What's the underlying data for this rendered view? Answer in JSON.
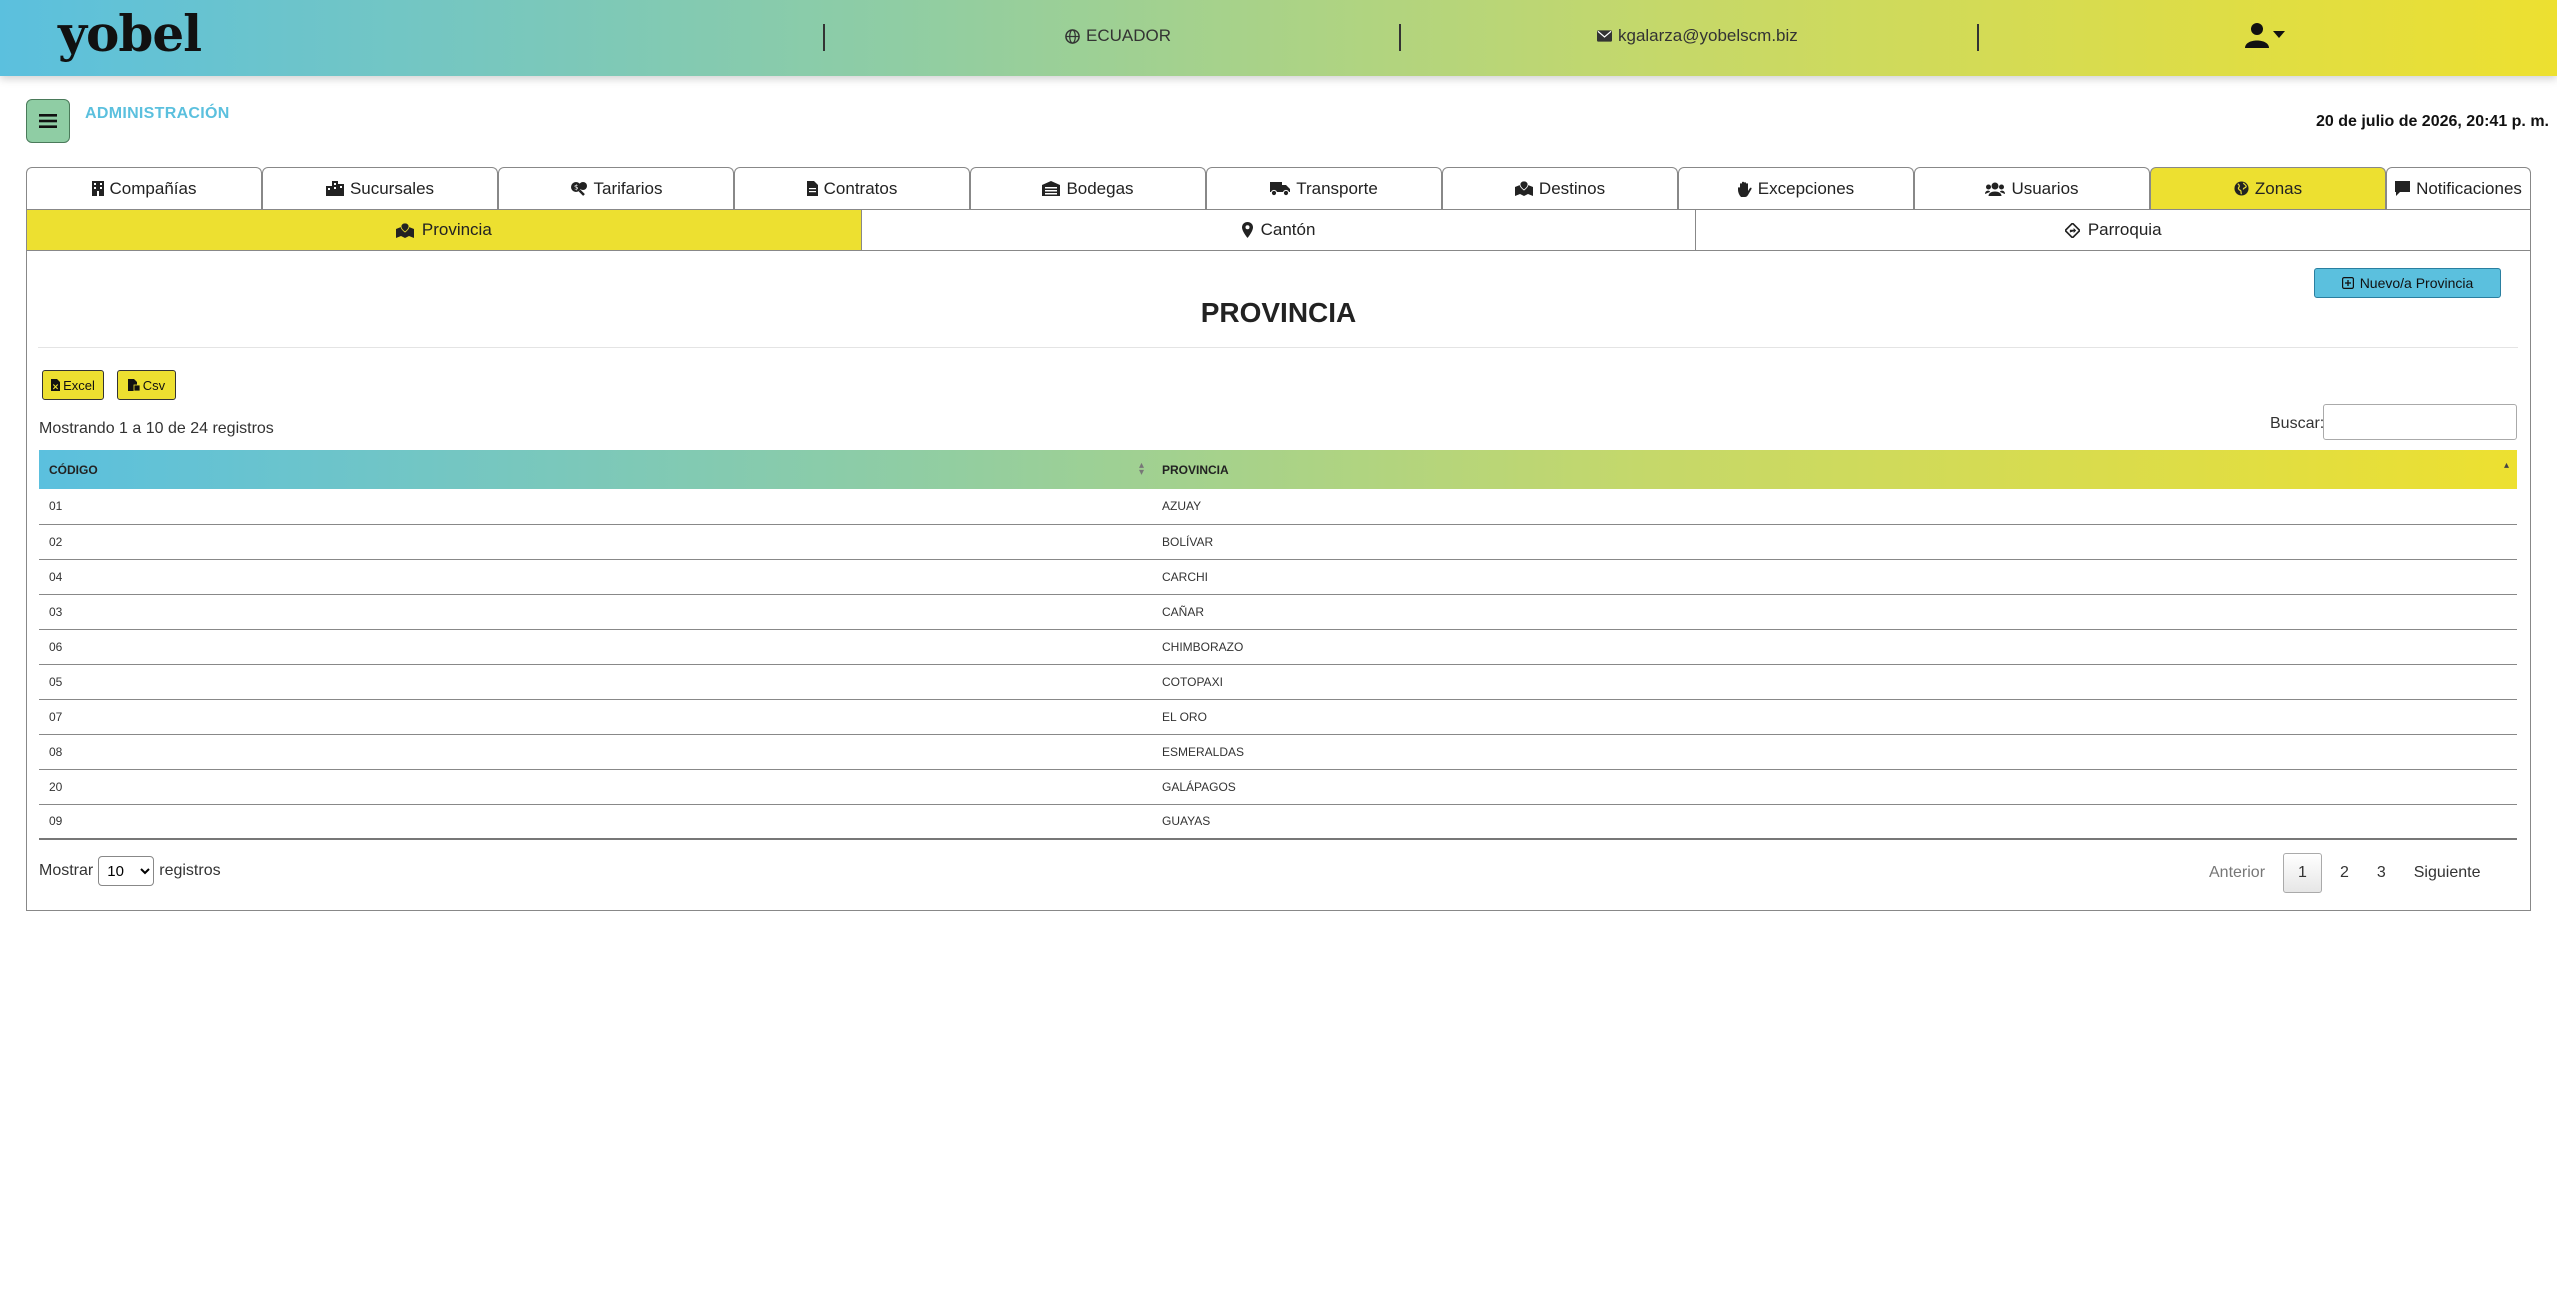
{
  "header": {
    "logo": "yobel",
    "country": "ECUADOR",
    "email": "kgalarza@yobelscm.biz",
    "icons": {
      "country": "globe-icon",
      "email": "envelope-icon",
      "user": "user-icon"
    }
  },
  "admin": {
    "label": "ADMINISTRACIÓN",
    "datetime": "20 de julio de 2026, 20:41 p. m."
  },
  "tabs": [
    {
      "label": "Compañías",
      "icon": "building-icon"
    },
    {
      "label": "Sucursales",
      "icon": "city-icon"
    },
    {
      "label": "Tarifarios",
      "icon": "search-dollar-icon"
    },
    {
      "label": "Contratos",
      "icon": "file-icon"
    },
    {
      "label": "Bodegas",
      "icon": "warehouse-icon"
    },
    {
      "label": "Transporte",
      "icon": "truck-icon"
    },
    {
      "label": "Destinos",
      "icon": "map-marked-icon"
    },
    {
      "label": "Excepciones",
      "icon": "hand-icon"
    },
    {
      "label": "Usuarios",
      "icon": "users-icon"
    },
    {
      "label": "Zonas",
      "icon": "globe-americas-icon",
      "active": true
    },
    {
      "label": "Notificaciones",
      "icon": "comment-icon"
    }
  ],
  "subtabs": [
    {
      "label": "Provincia",
      "icon": "map-marked-icon",
      "active": true
    },
    {
      "label": "Cantón",
      "icon": "map-marker-icon"
    },
    {
      "label": "Parroquia",
      "icon": "directions-icon"
    }
  ],
  "section": {
    "title": "PROVINCIA",
    "new_button": "Nuevo/a Provincia",
    "excel_button": "Excel",
    "csv_button": "Csv",
    "info": "Mostrando 1 a 10 de 24 registros",
    "search_label": "Buscar:",
    "search_value": ""
  },
  "table": {
    "columns": [
      "CÓDIGO",
      "PROVINCIA"
    ],
    "rows": [
      [
        "01",
        "AZUAY"
      ],
      [
        "02",
        "BOLÍVAR"
      ],
      [
        "04",
        "CARCHI"
      ],
      [
        "03",
        "CAÑAR"
      ],
      [
        "06",
        "CHIMBORAZO"
      ],
      [
        "05",
        "COTOPAXI"
      ],
      [
        "07",
        "EL ORO"
      ],
      [
        "08",
        "ESMERALDAS"
      ],
      [
        "20",
        "GALÁPAGOS"
      ],
      [
        "09",
        "GUAYAS"
      ]
    ]
  },
  "footer": {
    "show_label": "Mostrar",
    "length_value": "10",
    "records_label": "registros",
    "prev": "Anterior",
    "pages": [
      "1",
      "2",
      "3"
    ],
    "current_page": "1",
    "next": "Siguiente"
  },
  "colors": {
    "accent_yellow": "#ede030",
    "accent_blue": "#5bc0de",
    "accent_green": "#8fcda4"
  }
}
